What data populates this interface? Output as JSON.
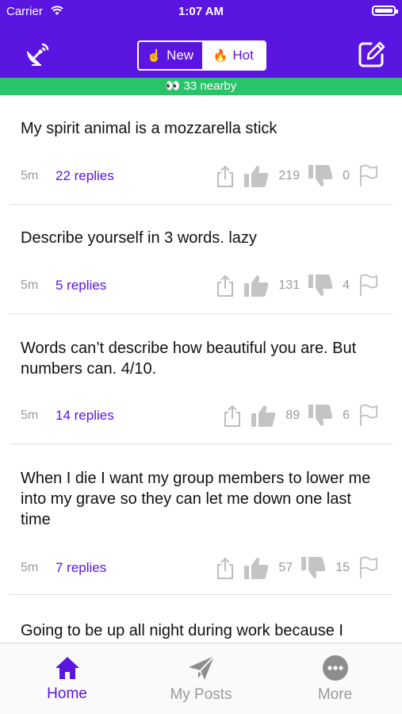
{
  "status_bar": {
    "carrier": "Carrier",
    "time": "1:07 AM"
  },
  "header": {
    "segment": {
      "new_label": "New",
      "hot_label": "Hot",
      "new_emoji": "☝️",
      "hot_emoji": "🔥",
      "selected": "Hot"
    },
    "nearby": "👀 33 nearby",
    "left_icon": "satellite-dish-icon",
    "right_icon": "compose-icon"
  },
  "posts": [
    {
      "text": "My spirit animal is a mozzarella stick",
      "age": "5m",
      "replies": "22 replies",
      "upvotes": "219",
      "downvotes": "0"
    },
    {
      "text": "Describe yourself in 3 words. lazy",
      "age": "5m",
      "replies": "5 replies",
      "upvotes": "131",
      "downvotes": "4"
    },
    {
      "text": "Words can’t describe how beautiful you are. But numbers can. 4/10.",
      "age": "5m",
      "replies": "14 replies",
      "upvotes": "89",
      "downvotes": "6"
    },
    {
      "text": "When I die I want my group members to lower me into my grave so they can let me down one last time",
      "age": "5m",
      "replies": "7 replies",
      "upvotes": "57",
      "downvotes": "15"
    },
    {
      "text": "Going to be up all night during work because I"
    }
  ],
  "tabs": [
    {
      "label": "Home",
      "icon": "home-icon"
    },
    {
      "label": "My Posts",
      "icon": "paper-plane-icon"
    },
    {
      "label": "More",
      "icon": "more-icon"
    }
  ],
  "colors": {
    "primary": "#5a16e0",
    "nearby_bar": "#29c36a",
    "muted": "#9a9a9a"
  }
}
